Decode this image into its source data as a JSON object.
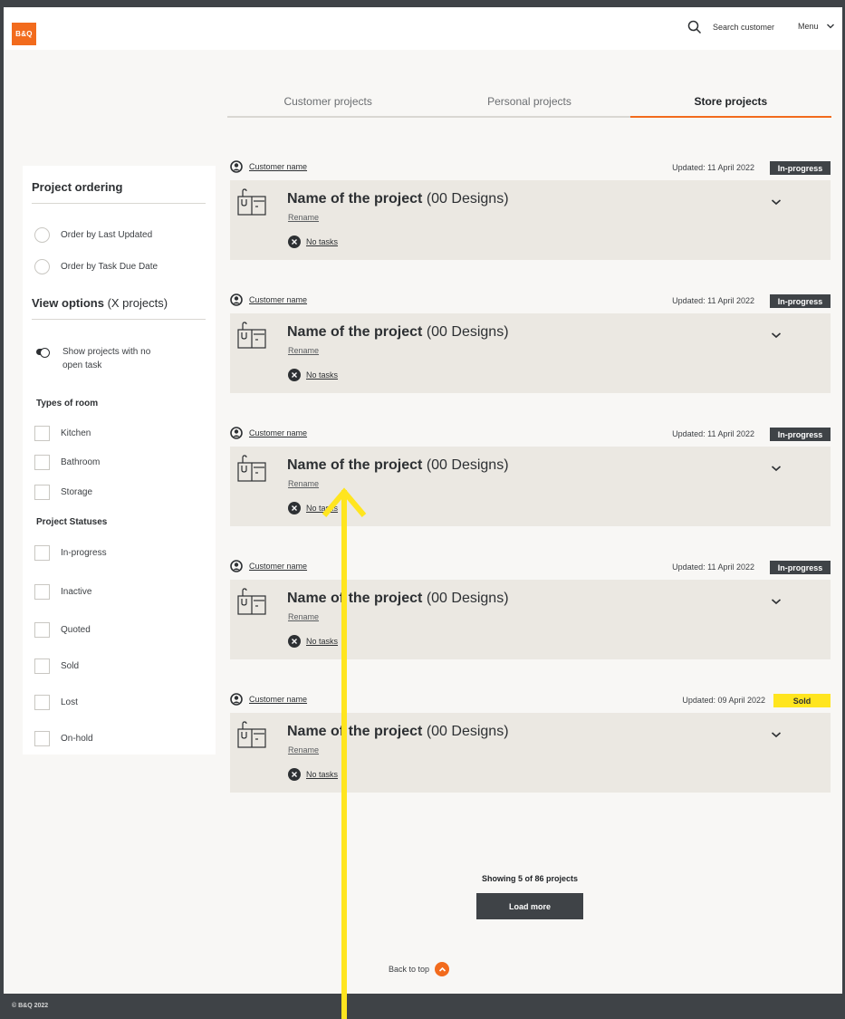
{
  "header": {
    "logo_text": "B&Q",
    "search_label": "Search customer",
    "menu_label": "Menu"
  },
  "tabs": [
    {
      "label": "Customer projects",
      "active": false
    },
    {
      "label": "Personal projects",
      "active": false
    },
    {
      "label": "Store projects",
      "active": true
    }
  ],
  "sidebar": {
    "ordering_title": "Project ordering",
    "order_options": [
      "Order by Last Updated",
      "Order by Task Due Date"
    ],
    "view_title": "View options",
    "view_count": "(X projects)",
    "toggle_label": "Show projects with no open task",
    "room_title": "Types of room",
    "rooms": [
      "Kitchen",
      "Bathroom",
      "Storage"
    ],
    "status_title": "Project Statuses",
    "statuses": [
      "In-progress",
      "Inactive",
      "Quoted",
      "Sold",
      "Lost",
      "On-hold"
    ]
  },
  "projects": [
    {
      "customer": "Customer name",
      "updated": "Updated: 11 April 2022",
      "status": "In-progress",
      "name": "Name of the project",
      "designs": "(00 Designs)",
      "rename": "Rename",
      "tasks": "No tasks"
    },
    {
      "customer": "Customer name",
      "updated": "Updated: 11 April 2022",
      "status": "In-progress",
      "name": "Name of the project",
      "designs": "(00 Designs)",
      "rename": "Rename",
      "tasks": "No tasks"
    },
    {
      "customer": "Customer name",
      "updated": "Updated: 11 April 2022",
      "status": "In-progress",
      "name": "Name of the project",
      "designs": "(00 Designs)",
      "rename": "Rename",
      "tasks": "No tasks"
    },
    {
      "customer": "Customer name",
      "updated": "Updated: 11 April 2022",
      "status": "In-progress",
      "name": "Name of the project",
      "designs": "(00 Designs)",
      "rename": "Rename",
      "tasks": "No tasks"
    },
    {
      "customer": "Customer name",
      "updated": "Updated: 09 April 2022",
      "status": "Sold",
      "name": "Name of the project",
      "designs": "(00 Designs)",
      "rename": "Rename",
      "tasks": "No tasks"
    }
  ],
  "pagination": {
    "showing": "Showing 5 of 86 projects",
    "load_more": "Load more",
    "back_to_top": "Back to top"
  },
  "footer": {
    "copyright": "© B&Q 2022"
  },
  "colors": {
    "brand_orange": "#f26b1d",
    "dark": "#3f4347",
    "card_bg": "#ebe8e2",
    "sold_yellow": "#ffe51f",
    "annotation_arrow": "#ffe51f"
  }
}
